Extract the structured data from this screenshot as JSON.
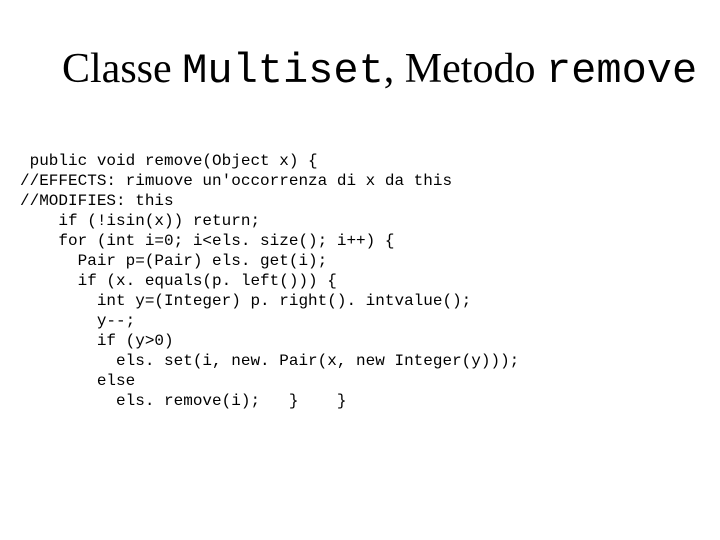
{
  "title": {
    "part1": "Classe ",
    "mono1": "Multiset",
    "part2": ", Metodo ",
    "mono2": "remove"
  },
  "code": {
    "l1": " public void remove(Object x) {",
    "l2": "//EFFECTS: rimuove un'occorrenza di x da this",
    "l3": "//MODIFIES: this",
    "l4": "    if (!isin(x)) return;",
    "l5": "    for (int i=0; i<els. size(); i++) {",
    "l6": "      Pair p=(Pair) els. get(i);",
    "l7": "      if (x. equals(p. left())) {",
    "l8": "        int y=(Integer) p. right(). intvalue();",
    "l9": "        y--;",
    "l10": "        if (y>0)",
    "l11": "          els. set(i, new. Pair(x, new Integer(y)));",
    "l12": "        else",
    "l13": "          els. remove(i);   }    }"
  }
}
